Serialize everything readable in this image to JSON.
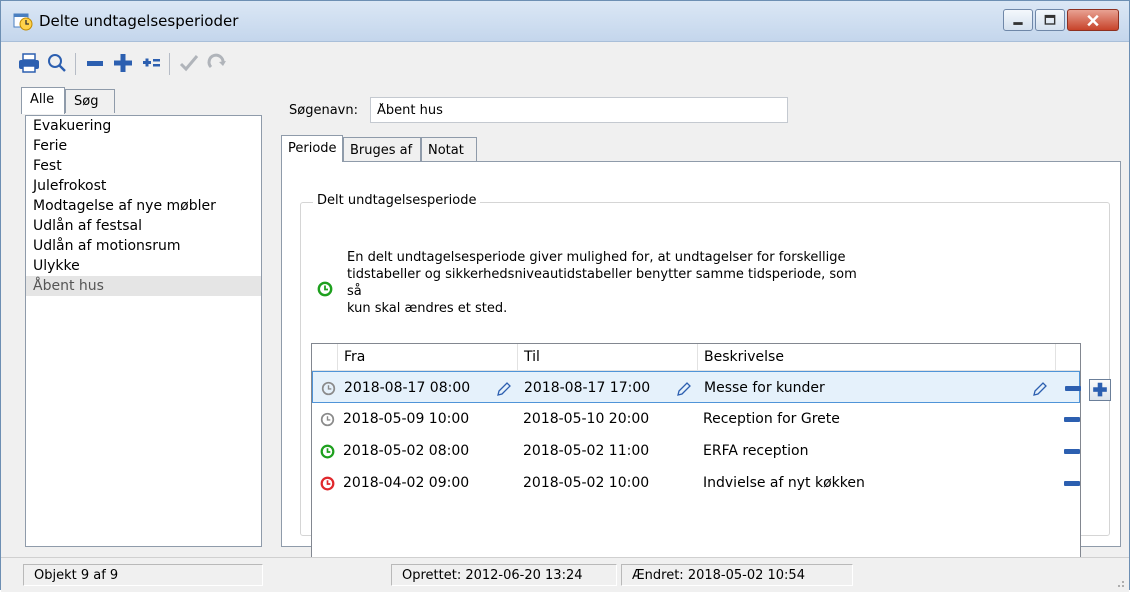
{
  "window": {
    "title": "Delte undtagelsesperioder",
    "icon": "clock-calendar-icon"
  },
  "toolbar": {
    "icons": [
      "print-icon",
      "search-icon",
      "remove-icon",
      "add-icon",
      "add-multiple-icon",
      "confirm-icon",
      "refresh-icon"
    ]
  },
  "left": {
    "tabs": [
      "Alle",
      "Søg"
    ],
    "items": [
      "Evakuering",
      "Ferie",
      "Fest",
      "Julefrokost",
      "Modtagelse af nye møbler",
      "Udlån af festsal",
      "Udlån af motionsrum",
      "Ulykke",
      "Åbent hus"
    ],
    "selected_index": 8
  },
  "main": {
    "search_label": "Søgenavn:",
    "search_value": "Åbent hus",
    "tabs": [
      "Periode",
      "Bruges af",
      "Notat"
    ],
    "group_title": "Delt undtagelsesperiode",
    "info_lines": [
      "En delt undtagelsesperiode giver mulighed for, at undtagelser for forskellige",
      "tidstabeller og sikkerhedsniveautidstabeller benytter samme tidsperiode, som så",
      "kun skal ændres et sted."
    ],
    "grid": {
      "columns": [
        "Fra",
        "Til",
        "Beskrivelse"
      ],
      "rows": [
        {
          "status": "grey",
          "from": "2018-08-17  08:00",
          "to": "2018-08-17  17:00",
          "desc": "Messe for kunder"
        },
        {
          "status": "grey",
          "from": "2018-05-09  10:00",
          "to": "2018-05-10  20:00",
          "desc": "Reception for Grete"
        },
        {
          "status": "green",
          "from": "2018-05-02  08:00",
          "to": "2018-05-02  11:00",
          "desc": "ERFA reception"
        },
        {
          "status": "red",
          "from": "2018-04-02  09:00",
          "to": "2018-05-02  10:00",
          "desc": "Indvielse af nyt køkken"
        }
      ]
    }
  },
  "status": {
    "object": "Objekt 9 af 9",
    "created": "Oprettet: 2012-06-20  13:24",
    "modified": "Ændret: 2018-05-02  10:54"
  },
  "colors": {
    "grey_status": "#8a8a8a",
    "green_status": "#1ea01e",
    "red_status": "#e0282c",
    "accent_blue": "#2c5fb0"
  }
}
